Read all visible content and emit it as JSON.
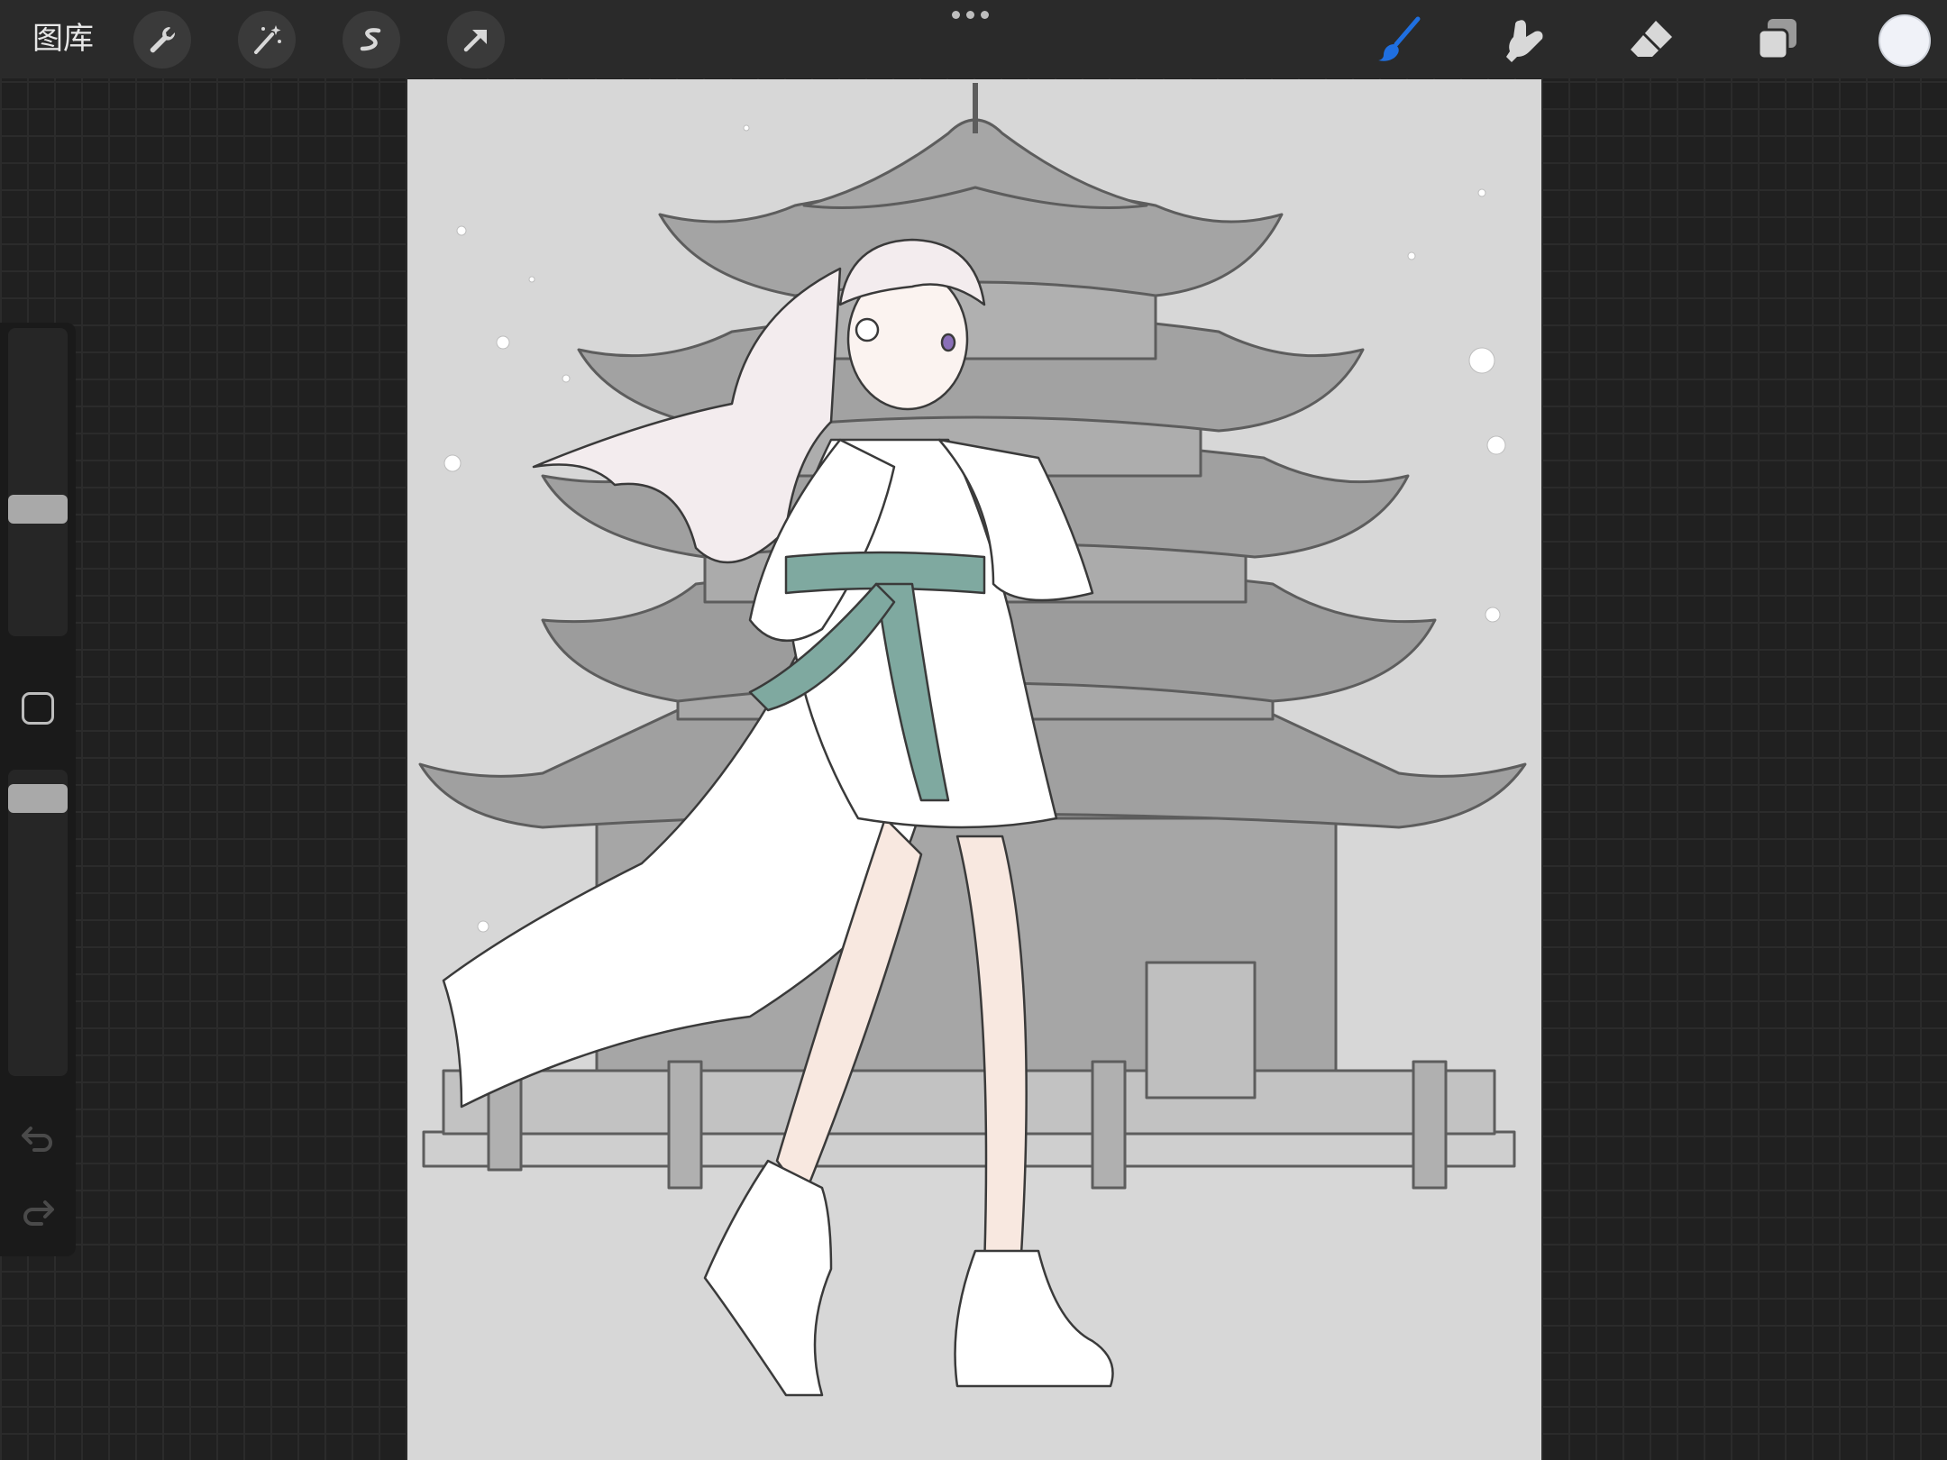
{
  "toolbar": {
    "gallery_label": "图库",
    "left_tools": [
      "wrench-icon",
      "magic-wand-icon",
      "selection-s-icon",
      "transform-arrow-icon"
    ],
    "right_tools": [
      "brush-icon",
      "smudge-icon",
      "eraser-icon",
      "layers-icon"
    ],
    "active_tool": "brush-icon",
    "active_color": "#1f6fe0",
    "current_color": "#f0f2f8"
  },
  "sidebar": {
    "brush_size_level": 0.58,
    "opacity_level": 0.5,
    "icons": [
      "modify-square-icon",
      "undo-icon",
      "redo-icon"
    ]
  },
  "canvas": {
    "background": "#d7d7d7",
    "subject": "pagoda-and-girl-illustration"
  }
}
